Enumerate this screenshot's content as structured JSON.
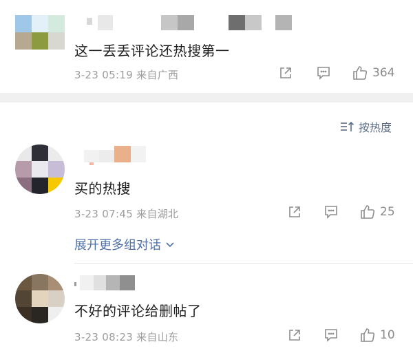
{
  "comments": [
    {
      "text": "这一丢丢评论还热搜第一",
      "meta": "3-23 05:19 来自广西",
      "likes": "364"
    },
    {
      "text": "买的热搜",
      "meta": "3-23 07:45 来自湖北",
      "likes": "25"
    },
    {
      "text": "不好的评论给删帖了",
      "meta": "3-23 08:23 来自山东",
      "likes": "10"
    }
  ],
  "sort_label": "按热度",
  "expand_label": "展开更多组对话",
  "icons": {
    "share": "share-icon",
    "comment": "comment-icon",
    "like": "thumbs-up-icon",
    "sort": "sort-icon",
    "expand": "chevron-down-icon"
  },
  "colors": {
    "link": "#4e6fa8",
    "meta": "#9c9c9c",
    "divider": "#f0f0f0"
  }
}
